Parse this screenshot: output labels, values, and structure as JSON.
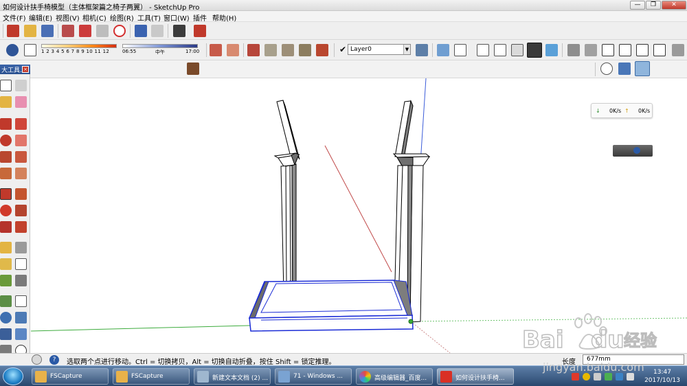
{
  "window": {
    "title": "如何设计扶手椅模型（主体框架篇之椅子两翼） - SketchUp Pro",
    "minimize": "—",
    "maximize": "❐",
    "close": "✕"
  },
  "menu": [
    "文件(F)",
    "编辑(E)",
    "视图(V)",
    "相机(C)",
    "绘图(R)",
    "工具(T)",
    "窗口(W)",
    "插件",
    "帮助(H)"
  ],
  "shadow_scale": {
    "numbers": "1  2  3  4  5  6  7  8  9  10 11 12"
  },
  "time_scale": {
    "start": "06:55",
    "mid": "中午",
    "end": "17:00"
  },
  "layer": {
    "check": "✔",
    "name": "Layer0",
    "arrow": "▼"
  },
  "left_panel": {
    "title": "大工具...",
    "close": "×"
  },
  "speed_widget": {
    "down_arrow": "↓",
    "down": "0K/s",
    "up_arrow": "↑",
    "up": "0K/s"
  },
  "status": {
    "help": "?",
    "text": "选取两个点进行移动。Ctrl = 切换拷贝，Alt = 切换自动折叠，按住 Shift = 锁定推理。",
    "length_label": "长度",
    "length_value": "677mm"
  },
  "taskbar": {
    "buttons": [
      {
        "label": "FSCapture",
        "color": "#e8b24a"
      },
      {
        "label": "FSCapture",
        "color": "#e8b24a"
      },
      {
        "label": "新建文本文档 (2) ...",
        "color": "#9fb7cf"
      },
      {
        "label": "71 - Windows ...",
        "color": "#7aa3d2"
      },
      {
        "label": "高级编辑器_百度...",
        "color": "#e74c3c"
      },
      {
        "label": "如何设计扶手椅...",
        "color": "#d93025"
      }
    ],
    "clock_time": "13:47",
    "clock_date": "2017/10/13"
  },
  "watermark": {
    "brand": "Bai",
    "brand_end": "du",
    "cn": "经验",
    "url": "jingyan.baidu.com"
  }
}
